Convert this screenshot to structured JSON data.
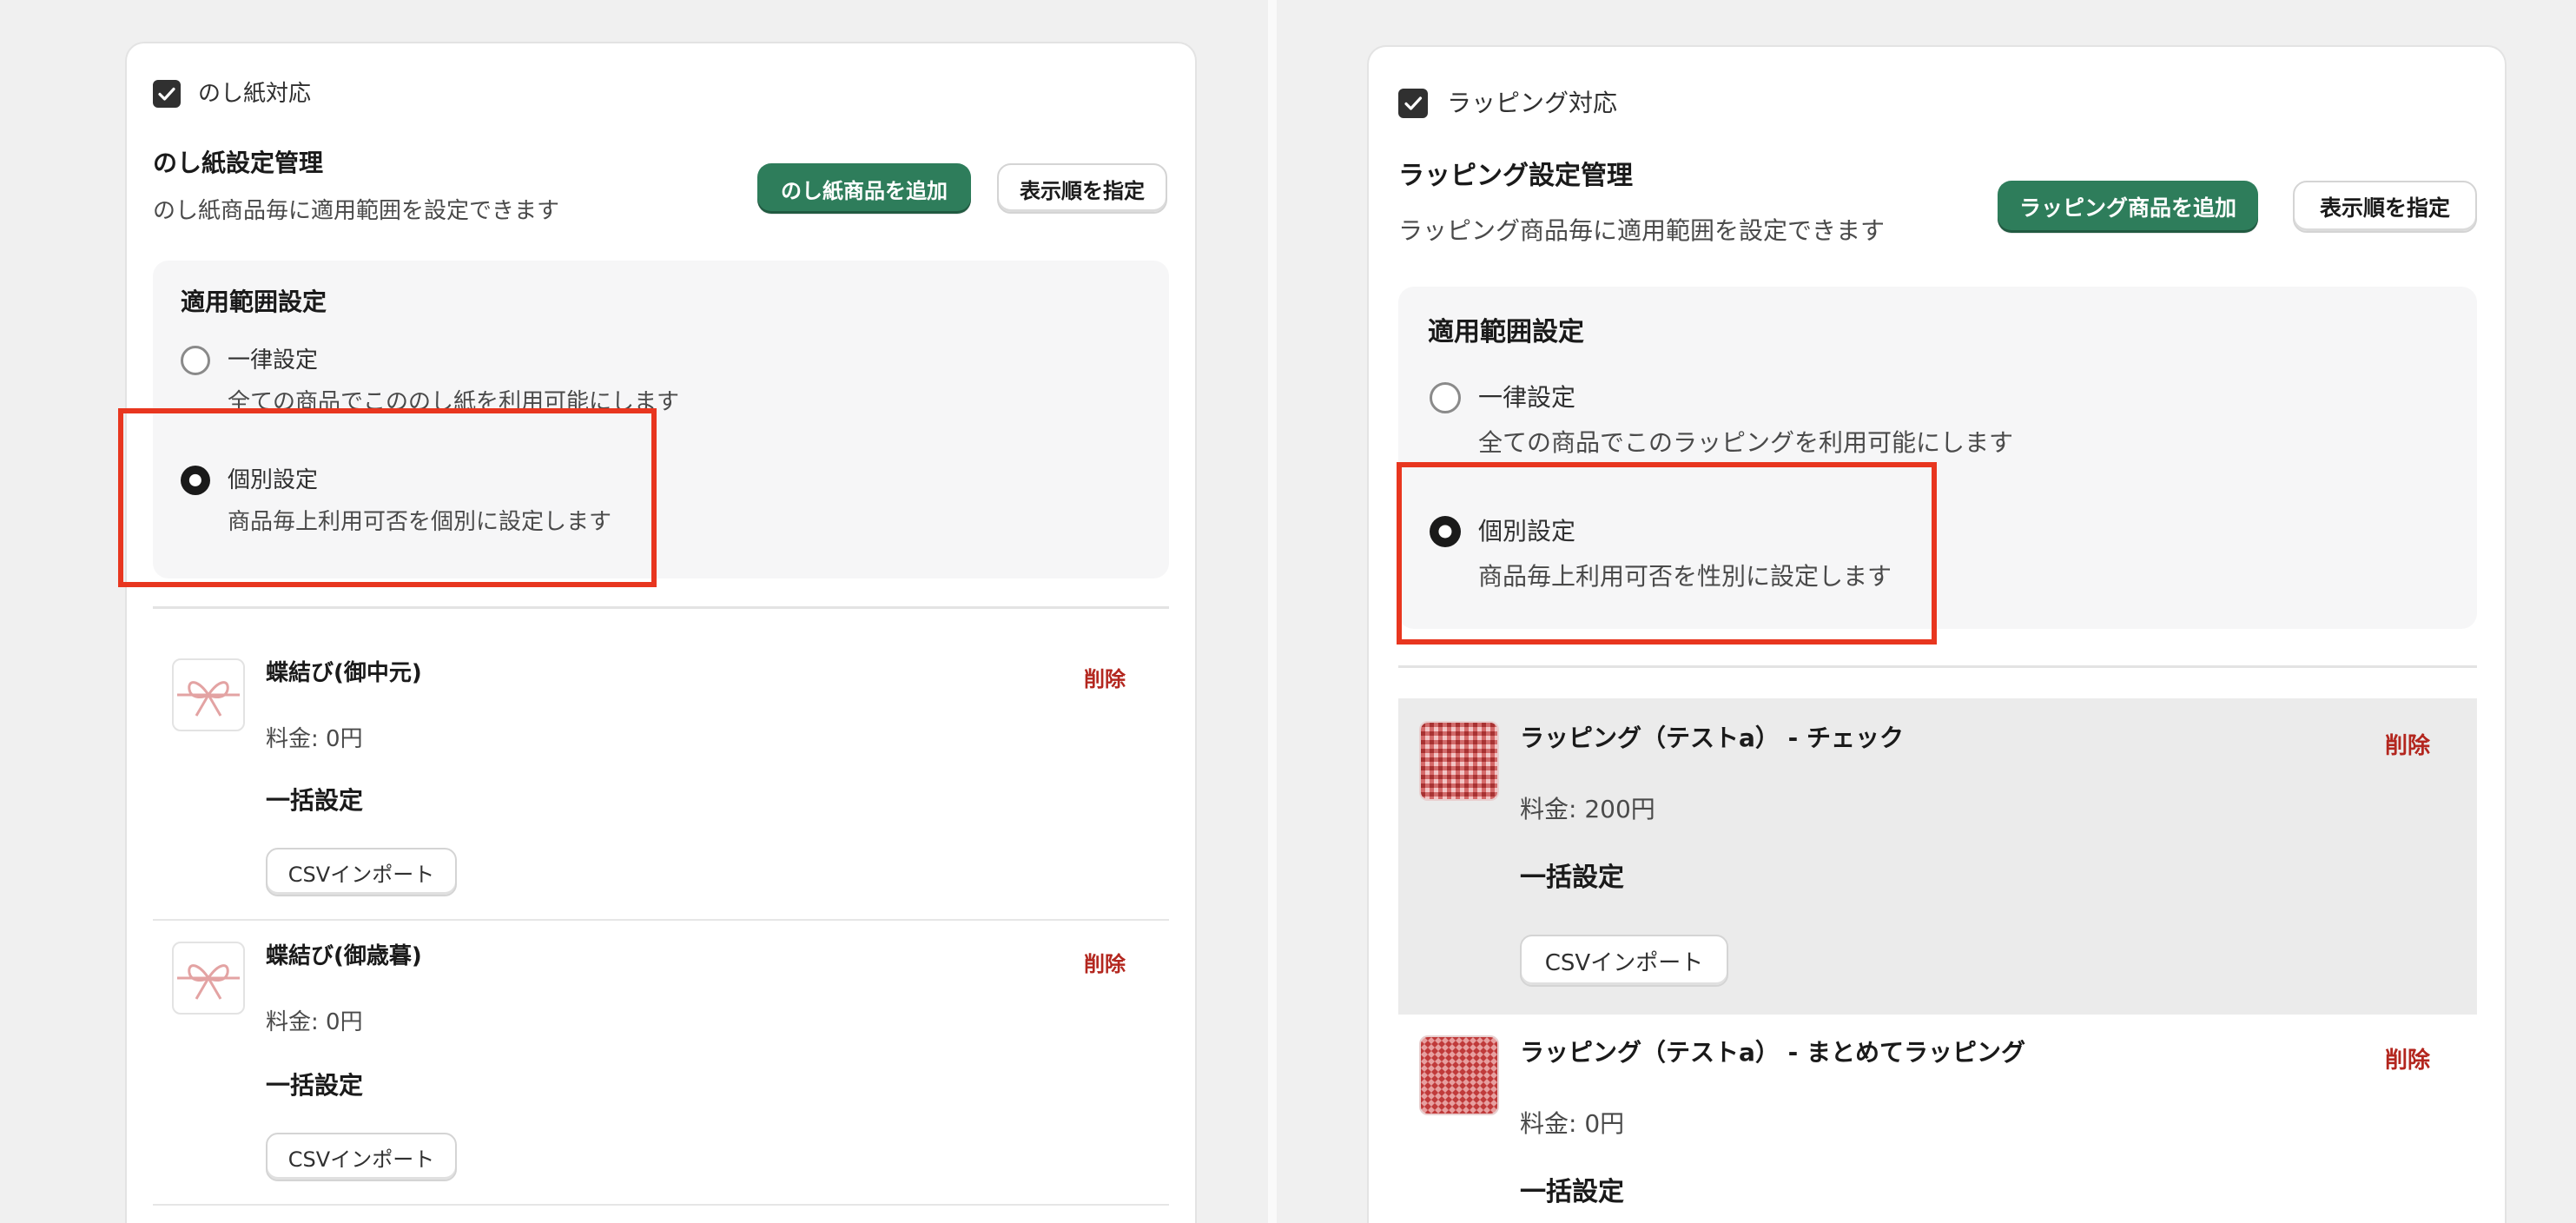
{
  "colors": {
    "primary_button": "#2e7d5b",
    "delete_text": "#b3261e",
    "highlight_box": "#e8361f",
    "selected_row": "#ebebeb"
  },
  "left": {
    "checkbox_label": "のし紙対応",
    "section_title": "のし紙設定管理",
    "section_desc": "のし紙商品毎に適用範囲を設定できます",
    "add_button": "のし紙商品を追加",
    "order_button": "表示順を指定",
    "scope": {
      "title": "適用範囲設定",
      "uniform_label": "一律設定",
      "uniform_desc": "全ての商品でこののし紙を利用可能にします",
      "individual_label": "個別設定",
      "individual_desc": "商品毎上利用可否を個別に設定します",
      "selected": "個別設定"
    },
    "products": [
      {
        "name": "蝶結び(御中元)",
        "price": "料金: 0円",
        "bulk_label": "一括設定",
        "csv_button": "CSVインポート",
        "delete_label": "削除",
        "icon": "ribbon-icon"
      },
      {
        "name": "蝶結び(御歳暮)",
        "price": "料金: 0円",
        "bulk_label": "一括設定",
        "csv_button": "CSVインポート",
        "delete_label": "削除",
        "icon": "ribbon-icon"
      }
    ]
  },
  "right": {
    "checkbox_label": "ラッピング対応",
    "section_title": "ラッピング設定管理",
    "section_desc": "ラッピング商品毎に適用範囲を設定できます",
    "add_button": "ラッピング商品を追加",
    "order_button": "表示順を指定",
    "scope": {
      "title": "適用範囲設定",
      "uniform_label": "一律設定",
      "uniform_desc": "全ての商品でこのラッピングを利用可能にします",
      "individual_label": "個別設定",
      "individual_desc": "商品毎上利用可否を性別に設定します",
      "selected": "個別設定"
    },
    "products": [
      {
        "name": "ラッピング（テストa） - チェック",
        "price": "料金: 200円",
        "bulk_label": "一括設定",
        "csv_button": "CSVインポート",
        "delete_label": "削除",
        "icon": "check-pattern-icon"
      },
      {
        "name": "ラッピング（テストa） - まとめてラッピング",
        "price": "料金: 0円",
        "bulk_label": "一括設定",
        "delete_label": "削除",
        "icon": "diamond-pattern-icon"
      }
    ]
  }
}
